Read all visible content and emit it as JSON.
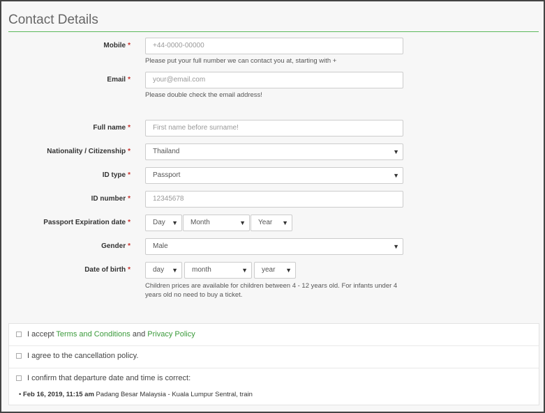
{
  "section_title": "Contact Details",
  "required_mark": "*",
  "mobile": {
    "label": "Mobile",
    "placeholder": "+44-0000-00000",
    "help": "Please put your full number we can contact you at, starting with +"
  },
  "email": {
    "label": "Email",
    "placeholder": "your@email.com",
    "help": "Please double check the email address!"
  },
  "full_name": {
    "label": "Full name",
    "placeholder": "First name before surname!"
  },
  "nationality": {
    "label": "Nationality / Citizenship",
    "value": "Thailand"
  },
  "id_type": {
    "label": "ID type",
    "value": "Passport"
  },
  "id_number": {
    "label": "ID number",
    "placeholder": "12345678"
  },
  "passport_expiration": {
    "label": "Passport Expiration date",
    "day": "Day",
    "month": "Month",
    "year": "Year"
  },
  "gender": {
    "label": "Gender",
    "value": "Male"
  },
  "dob": {
    "label": "Date of birth",
    "day": "day",
    "month": "month",
    "year": "year",
    "help": "Children prices are available for children between 4 - 12 years old. For infants under 4 years old no need to buy a ticket."
  },
  "agreements": {
    "terms_prefix": "I accept",
    "terms_link": "Terms and Conditions",
    "and": "and",
    "privacy_link": "Privacy Policy",
    "cancellation": "I agree to the cancellation policy.",
    "confirm": "I confirm that departure date and time is correct:",
    "trip_datetime": "Feb 16, 2019, 11:15 am",
    "trip_route": "Padang Besar Malaysia - Kuala Lumpur Sentral, train"
  },
  "colors": {
    "accent": "#5cb85c",
    "link": "#3a9a3a",
    "required": "#c9302c"
  },
  "icons": {
    "select_arrow": "▼",
    "bullet": "•"
  }
}
